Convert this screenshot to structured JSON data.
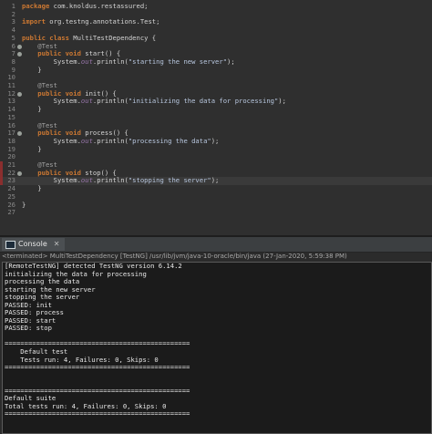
{
  "editor": {
    "lines": [
      {
        "n": "1",
        "parts": [
          {
            "t": "package com.knoldus.restassured;",
            "c": "kw-mix"
          }
        ]
      },
      {
        "n": "2",
        "parts": []
      },
      {
        "n": "3",
        "parts": [
          {
            "t": "import",
            "c": "kw"
          },
          {
            "t": " org.testng.annotations.Test;",
            "c": ""
          }
        ]
      },
      {
        "n": "4",
        "parts": []
      },
      {
        "n": "5",
        "parts": [
          {
            "t": "public class",
            "c": "kw"
          },
          {
            "t": " MultiTestDependency {",
            "c": ""
          }
        ]
      },
      {
        "n": "6",
        "parts": [
          {
            "t": "    @Test",
            "c": "ann"
          }
        ]
      },
      {
        "n": "7",
        "parts": [
          {
            "t": "    public void",
            "c": "kw"
          },
          {
            "t": " start() {",
            "c": ""
          }
        ]
      },
      {
        "n": "8",
        "parts": [
          {
            "t": "        System.",
            "c": ""
          },
          {
            "t": "out",
            "c": "fld"
          },
          {
            "t": ".println(",
            "c": ""
          },
          {
            "t": "\"starting the new server\"",
            "c": "str"
          },
          {
            "t": ");",
            "c": ""
          }
        ]
      },
      {
        "n": "9",
        "parts": [
          {
            "t": "    }",
            "c": ""
          }
        ]
      },
      {
        "n": "10",
        "parts": []
      },
      {
        "n": "11",
        "parts": [
          {
            "t": "    @Test",
            "c": "ann"
          }
        ]
      },
      {
        "n": "12",
        "parts": [
          {
            "t": "    public void",
            "c": "kw"
          },
          {
            "t": " init() {",
            "c": ""
          }
        ]
      },
      {
        "n": "13",
        "parts": [
          {
            "t": "        System.",
            "c": ""
          },
          {
            "t": "out",
            "c": "fld"
          },
          {
            "t": ".println(",
            "c": ""
          },
          {
            "t": "\"initializing the data for processing\"",
            "c": "str"
          },
          {
            "t": ");",
            "c": ""
          }
        ]
      },
      {
        "n": "14",
        "parts": [
          {
            "t": "    }",
            "c": ""
          }
        ]
      },
      {
        "n": "15",
        "parts": []
      },
      {
        "n": "16",
        "parts": [
          {
            "t": "    @Test",
            "c": "ann"
          }
        ]
      },
      {
        "n": "17",
        "parts": [
          {
            "t": "    public void",
            "c": "kw"
          },
          {
            "t": " process() {",
            "c": ""
          }
        ]
      },
      {
        "n": "18",
        "parts": [
          {
            "t": "        System.",
            "c": ""
          },
          {
            "t": "out",
            "c": "fld"
          },
          {
            "t": ".println(",
            "c": ""
          },
          {
            "t": "\"processing the data\"",
            "c": "str"
          },
          {
            "t": ");",
            "c": ""
          }
        ]
      },
      {
        "n": "19",
        "parts": [
          {
            "t": "    }",
            "c": ""
          }
        ]
      },
      {
        "n": "20",
        "parts": []
      },
      {
        "n": "21",
        "parts": [
          {
            "t": "    @Test",
            "c": "ann"
          }
        ]
      },
      {
        "n": "22",
        "parts": [
          {
            "t": "    public void",
            "c": "kw"
          },
          {
            "t": " stop() {",
            "c": ""
          }
        ]
      },
      {
        "n": "23",
        "parts": [
          {
            "t": "        System.",
            "c": ""
          },
          {
            "t": "out",
            "c": "fld"
          },
          {
            "t": ".println(",
            "c": ""
          },
          {
            "t": "\"stopping the server\"",
            "c": "str"
          },
          {
            "t": ");",
            "c": ""
          }
        ]
      },
      {
        "n": "24",
        "parts": [
          {
            "t": "    }",
            "c": ""
          }
        ]
      },
      {
        "n": "25",
        "parts": []
      },
      {
        "n": "26",
        "parts": [
          {
            "t": "}",
            "c": ""
          }
        ]
      },
      {
        "n": "27",
        "parts": []
      }
    ],
    "gutter_dots": [
      "6",
      "7",
      "12",
      "17",
      "22"
    ],
    "error_markers": [
      "21",
      "22",
      "23"
    ],
    "current_line": "23"
  },
  "console": {
    "tab_label": "Console",
    "tab_close": "✕",
    "status": "<terminated> MultiTestDependency [TestNG] /usr/lib/jvm/java-10-oracle/bin/java (27-Jan-2020, 5:59:38 PM)",
    "output": [
      "[RemoteTestNG] detected TestNG version 6.14.2",
      "initializing the data for processing",
      "processing the data",
      "starting the new server",
      "stopping the server",
      "PASSED: init",
      "PASSED: process",
      "PASSED: start",
      "PASSED: stop",
      "",
      "===============================================",
      "    Default test",
      "    Tests run: 4, Failures: 0, Skips: 0",
      "===============================================",
      "",
      "",
      "===============================================",
      "Default suite",
      "Total tests run: 4, Failures: 0, Skips: 0",
      "==============================================="
    ]
  }
}
